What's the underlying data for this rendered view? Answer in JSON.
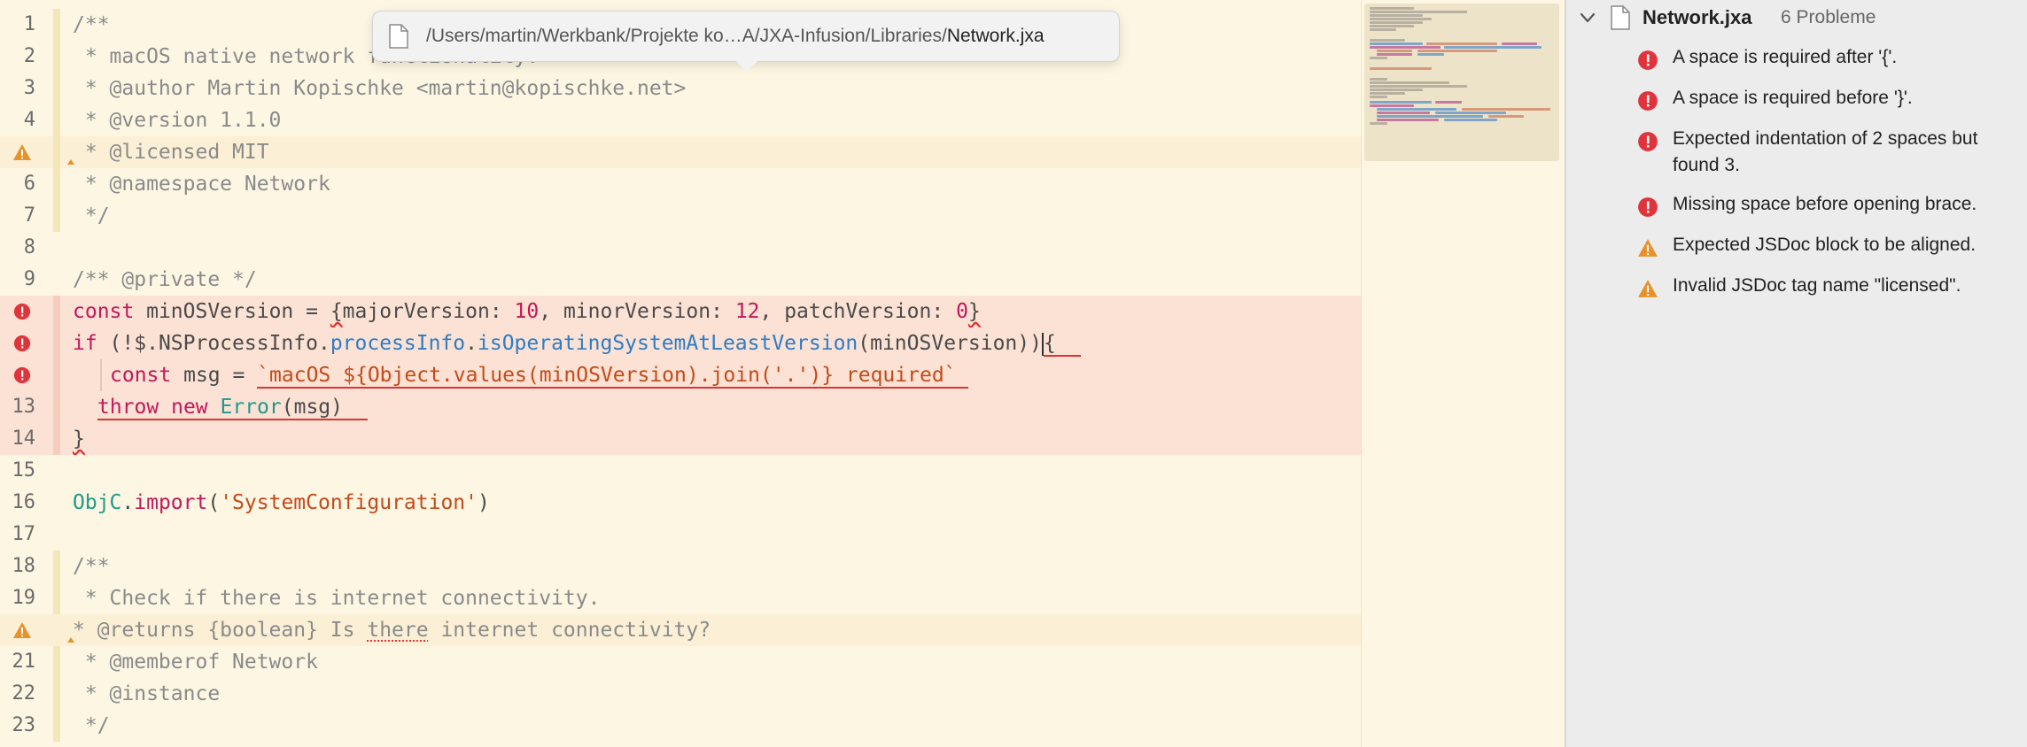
{
  "editor": {
    "lines": [
      {
        "n": "1",
        "t": "/**"
      },
      {
        "n": "2",
        "t": " * macOS native network functionality."
      },
      {
        "n": "3",
        "t": " * @author Martin Kopischke <martin@kopischke.net>"
      },
      {
        "n": "4",
        "t": " * @version 1.1.0"
      },
      {
        "n": "5",
        "t": " * @licensed MIT"
      },
      {
        "n": "6",
        "t": " * @namespace Network"
      },
      {
        "n": "7",
        "t": " */"
      },
      {
        "n": "8",
        "t": ""
      },
      {
        "n": "9",
        "t": "/** @private */"
      },
      {
        "n": "10",
        "kw": "const",
        "rest1": " minOSVersion = ",
        "brace": "{",
        "a": "majorVersion: ",
        "a_n": "10",
        "b": ", minorVersion: ",
        "b_n": "12",
        "c": ", patchVersion: ",
        "c_n": "0",
        "cl": "}"
      },
      {
        "n": "11",
        "kw": "if",
        "p1": " (!$.NSProcessInfo.",
        "m1": "processInfo",
        "dot": ".",
        "m2": "isOperatingSystemAtLeastVersion",
        "p2": "(minOSVersion))",
        "br": "{"
      },
      {
        "n": "12",
        "kw": "const",
        "p1": " msg = ",
        "s1": "`macOS ",
        "s2": "${",
        "s3": "Object.values(minOSVersion).join('.')",
        "s4": "}",
        "s5": " required`"
      },
      {
        "n": "13",
        "kw1": "throw",
        "kw2": "new",
        "cls": "Error",
        "p": "(msg)"
      },
      {
        "n": "14",
        "t": "}"
      },
      {
        "n": "15",
        "t": ""
      },
      {
        "n": "16",
        "obj": "ObjC",
        "dot": ".",
        "fn": "import",
        "p1": "(",
        "s": "'SystemConfiguration'",
        "p2": ")"
      },
      {
        "n": "17",
        "t": ""
      },
      {
        "n": "18",
        "t": "/**"
      },
      {
        "n": "19",
        "t": " * Check if there is internet connectivity."
      },
      {
        "n": "20",
        "a": "* @returns {boolean} Is ",
        "sq": "there",
        "b": " internet connectivity?"
      },
      {
        "n": "21",
        "t": " * @memberof Network"
      },
      {
        "n": "22",
        "t": " * @instance"
      },
      {
        "n": "23",
        "t": " */"
      }
    ]
  },
  "path_popover": {
    "path_prefix": "/Users/martin/Werkbank/Projekte ko…A/JXA-Infusion/Libraries/",
    "file_name": "Network.jxa"
  },
  "issues_panel": {
    "file_name": "Network.jxa",
    "count_label": "6 Probleme",
    "issues": [
      {
        "type": "error",
        "text": "A space is required after '{'."
      },
      {
        "type": "error",
        "text": "A space is required before '}'."
      },
      {
        "type": "error",
        "text": "Expected indentation of 2 spaces but found 3."
      },
      {
        "type": "error",
        "text": "Missing space before opening brace."
      },
      {
        "type": "warning",
        "text": "Expected JSDoc block to be aligned."
      },
      {
        "type": "warning",
        "text": "Invalid JSDoc tag name \"licensed\"."
      }
    ]
  },
  "colors": {
    "error": "#e0343c",
    "warning": "#e8912a",
    "editor_bg": "#fdf6e3",
    "keyword": "#c2185b",
    "string": "#c44a1a",
    "method": "#2f7cc4"
  }
}
